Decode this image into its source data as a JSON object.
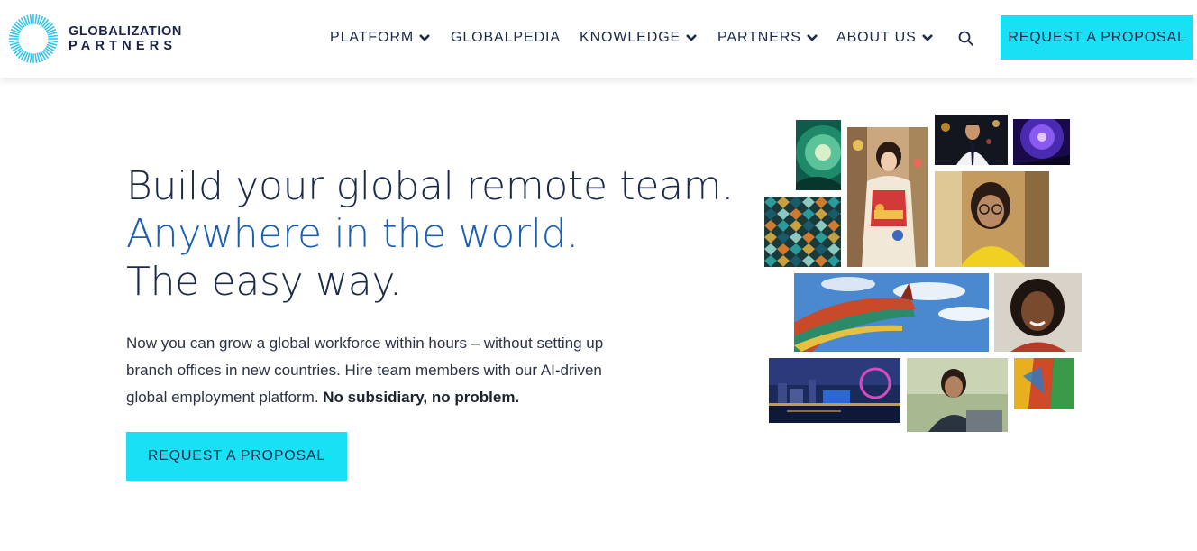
{
  "brand": {
    "name_line1": "GLOBALIZATION",
    "name_line2": "PARTNERS",
    "ring_color": "#2ec4e8"
  },
  "nav": {
    "items": [
      {
        "label": "PLATFORM",
        "has_dropdown": true
      },
      {
        "label": "GLOBALPEDIA",
        "has_dropdown": false
      },
      {
        "label": "KNOWLEDGE",
        "has_dropdown": true
      },
      {
        "label": "PARTNERS",
        "has_dropdown": true
      },
      {
        "label": "ABOUT US",
        "has_dropdown": true
      }
    ],
    "search_icon": "search-icon",
    "cta_label": "REQUEST A PROPOSAL"
  },
  "hero": {
    "title_line1": "Build your global remote team.",
    "title_line2": "Anywhere in the world.",
    "title_line3": "The easy way.",
    "body_text": "Now you can grow a global workforce within hours – without setting up branch offices in new countries. Hire team members with our AI-driven global employment platform.",
    "body_bold": "No subsidiary, no problem.",
    "cta_label": "REQUEST A PROPOSAL"
  },
  "collage": {
    "photos": [
      "green-dome-photo",
      "woman-in-kimono-photo",
      "man-with-phone-photo",
      "purple-lights-photo",
      "mosaic-tiles-photo",
      "woman-yellow-sweater-photo",
      "asian-temple-roof-photo",
      "smiling-woman-photo",
      "city-skyline-night-photo",
      "man-with-laptop-photo",
      "colorful-lanterns-photo"
    ]
  },
  "colors": {
    "accent_cyan": "#19e0f5",
    "navy_text": "#1c2a4a",
    "blue_accent": "#1a5fb4"
  }
}
